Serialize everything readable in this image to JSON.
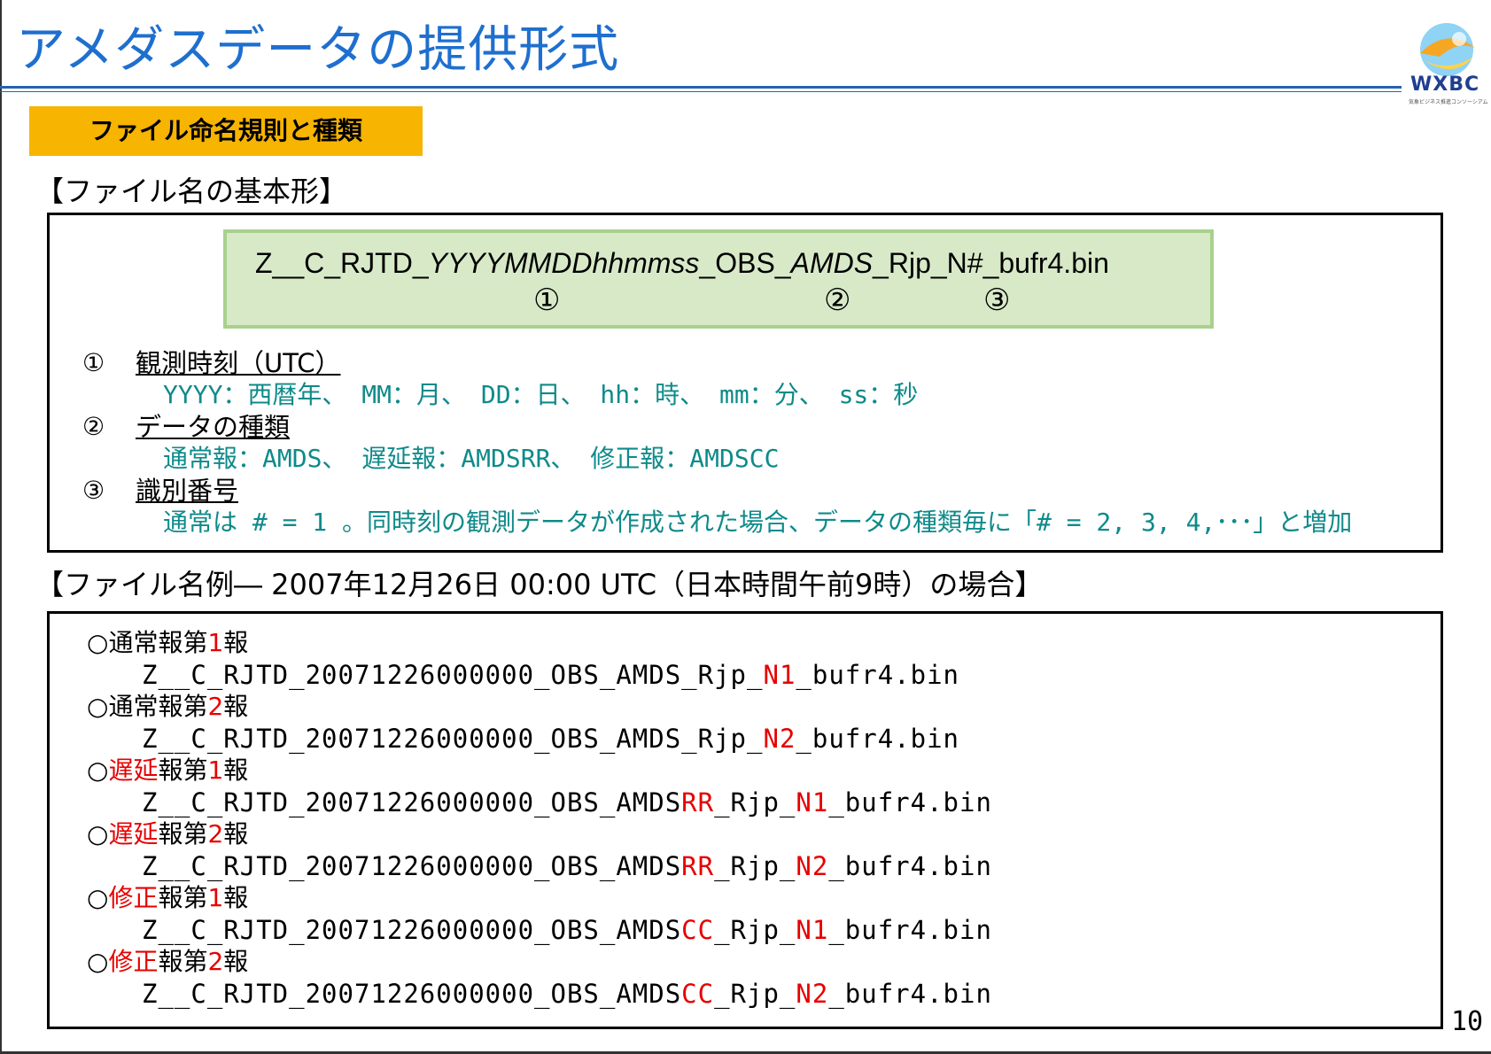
{
  "slide": {
    "title": "アメダスデータの提供形式",
    "page_number": "10"
  },
  "logo": {
    "text": "WXBC",
    "sub": "気象ビジネス推進コンソーシアム"
  },
  "section_badge": "ファイル命名規則と種類",
  "basic_form": {
    "heading": "【ファイル名の基本形】",
    "format": {
      "prefix": "Z__C_RJTD_",
      "time_part": "YYYYMMDDhhmmss",
      "mid": "_OBS_",
      "type_part": "AMDS",
      "suffix": "_Rjp_N#_bufr4.bin"
    },
    "markers": [
      "①",
      "②",
      "③"
    ],
    "items": [
      {
        "number": "①",
        "title": "観測時刻（UTC）",
        "description": "YYYY：西暦年、 MM：月、 DD：日、 hh：時、 mm：分、 ss：秒"
      },
      {
        "number": "②",
        "title": "データの種類",
        "description": "通常報：AMDS、 遅延報：AMDSRR、 修正報：AMDSCC"
      },
      {
        "number": "③",
        "title": "識別番号",
        "description": "通常は # = 1 。同時刻の観測データが作成された場合、データの種類毎に「# = 2, 3, 4,･･･」と増加"
      }
    ]
  },
  "examples": {
    "heading": "【ファイル名例― 2007年12月26日 00:00 UTC（日本時間午前9時）の場合】",
    "common_prefix": "Z__C_RJTD_20071226000000_OBS_AMDS",
    "common_mid": "_Rjp_",
    "common_suffix": "_bufr4.bin",
    "entries": [
      {
        "mark": "○",
        "kind": "通常",
        "kind_red": false,
        "report": "報第",
        "num": "1",
        "num_suffix": "報",
        "type_suffix": "",
        "n_code": "N1"
      },
      {
        "mark": "○",
        "kind": "通常",
        "kind_red": false,
        "report": "報第",
        "num": "2",
        "num_suffix": "報",
        "type_suffix": "",
        "n_code": "N2"
      },
      {
        "mark": "○",
        "kind": "遅延",
        "kind_red": true,
        "report": "報第",
        "num": "1",
        "num_suffix": "報",
        "type_suffix": "RR",
        "n_code": "N1"
      },
      {
        "mark": "○",
        "kind": "遅延",
        "kind_red": true,
        "report": "報第",
        "num": "2",
        "num_suffix": "報",
        "type_suffix": "RR",
        "n_code": "N2"
      },
      {
        "mark": "○",
        "kind": "修正",
        "kind_red": true,
        "report": "報第",
        "num": "1",
        "num_suffix": "報",
        "type_suffix": "CC",
        "n_code": "N1"
      },
      {
        "mark": "○",
        "kind": "修正",
        "kind_red": true,
        "report": "報第",
        "num": "2",
        "num_suffix": "報",
        "type_suffix": "CC",
        "n_code": "N2"
      }
    ]
  }
}
